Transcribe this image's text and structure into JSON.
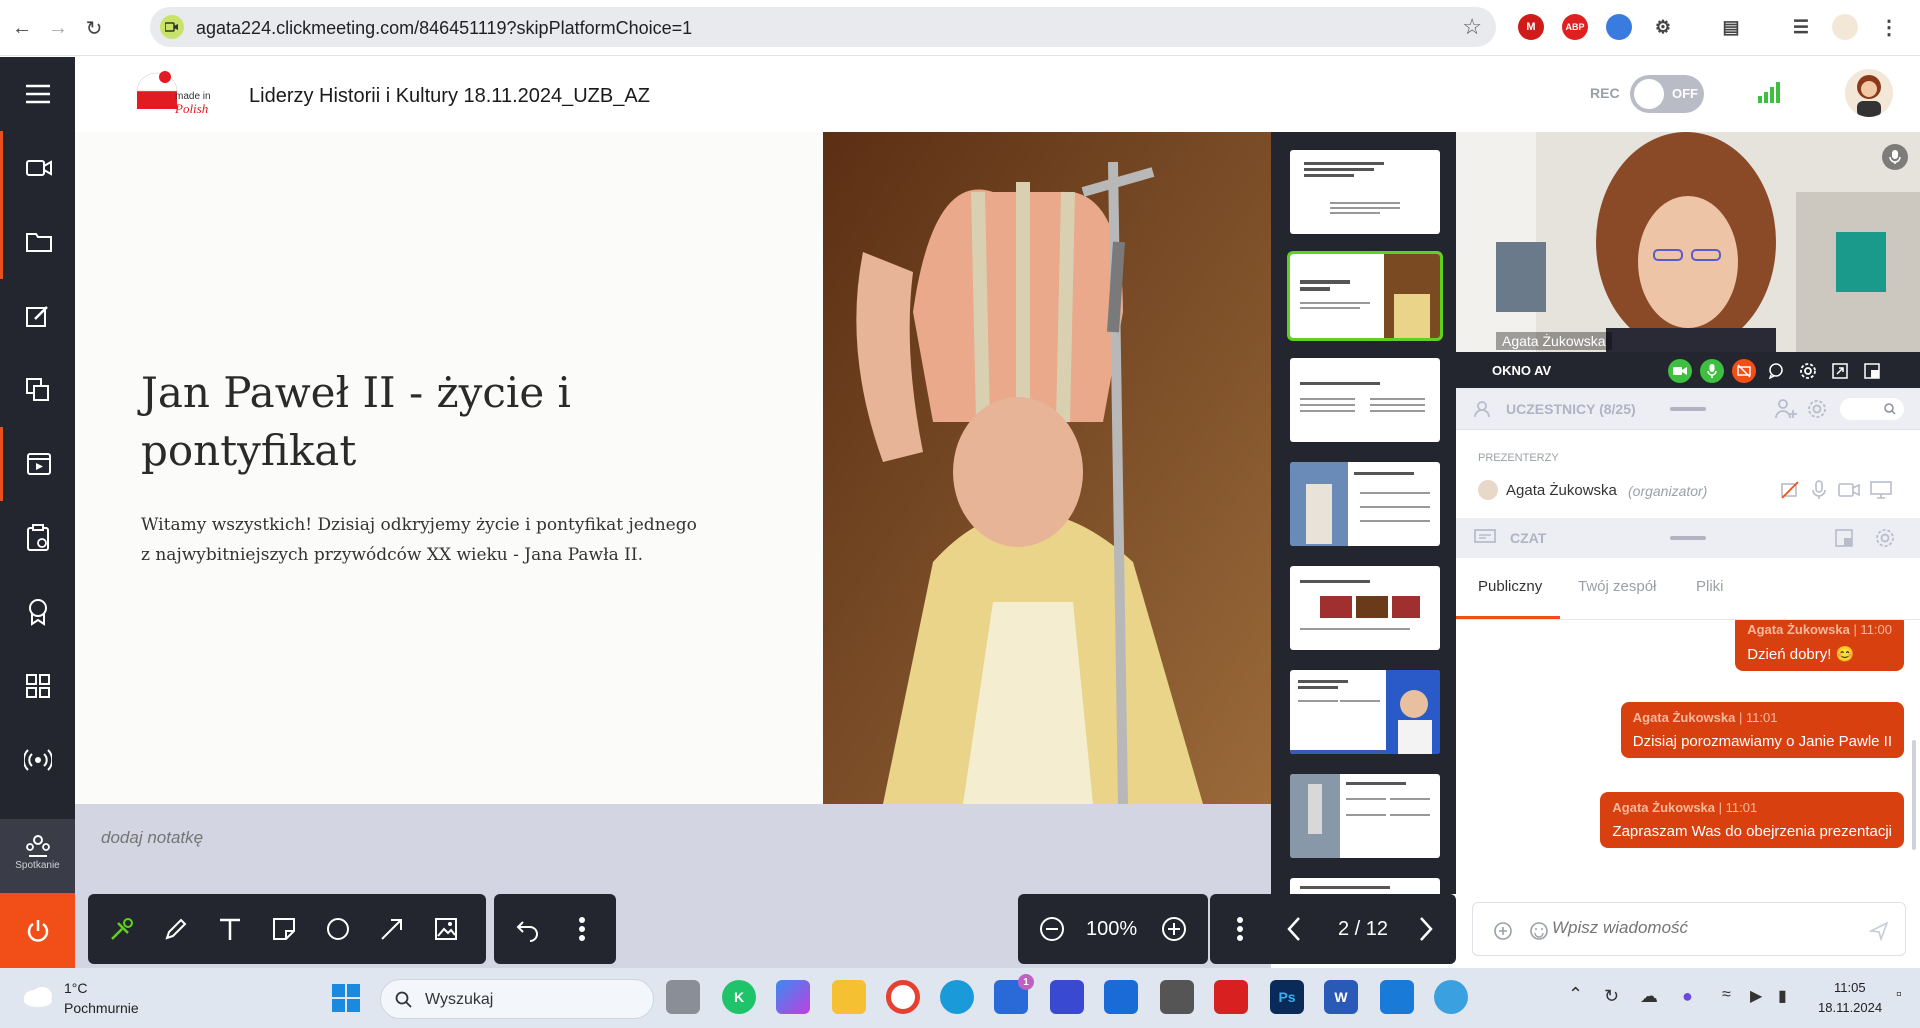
{
  "browser": {
    "url": "agata224.clickmeeting.com/846451119?skipPlatformChoice=1",
    "extensions": [
      "M",
      "ABP"
    ]
  },
  "sidebar": {
    "meeting_label": "Spotkanie"
  },
  "header": {
    "title": "Liderzy Historii i Kultury 18.11.2024_UZB_AZ",
    "logo_text": "made in Polish",
    "rec_label": "REC",
    "rec_state": "OFF"
  },
  "slide": {
    "title": "Jan Paweł II - życie i pontyfikat",
    "text": "Witamy wszystkich! Dzisiaj odkryjemy życie i pontyfikat jednego z najwybitniejszych przywódców XX wieku - Jana Pawła II."
  },
  "notes": {
    "placeholder": "dodaj notatkę"
  },
  "toolbar": {
    "zoom": "100%",
    "page": "2 / 12"
  },
  "video": {
    "name": "Agata Żukowska"
  },
  "av": {
    "label": "OKNO AV"
  },
  "participants": {
    "label": "UCZESTNICY (8/25)",
    "presenters_label": "PREZENTERZY",
    "presenter_name": "Agata Żukowska",
    "presenter_role": "(organizator)"
  },
  "chat": {
    "label": "CZAT",
    "tabs": [
      "Publiczny",
      "Twój zespół",
      "Pliki"
    ],
    "messages": [
      {
        "author": "Agata Żukowska",
        "time": "| 11:00",
        "text": "Dzień dobry! 😊"
      },
      {
        "author": "Agata Żukowska",
        "time": "| 11:01",
        "text": "Dzisiaj porozmawiamy o Janie Pawle II"
      },
      {
        "author": "Agata Żukowska",
        "time": "| 11:01",
        "text": "Zapraszam Was do obejrzenia prezentacji"
      }
    ],
    "input_placeholder": "Wpisz wiadomość"
  },
  "taskbar": {
    "weather_temp": "1°C",
    "weather_desc": "Pochmurnie",
    "search_placeholder": "Wyszukaj",
    "store_badge": "1",
    "time": "11:05",
    "date": "18.11.2024"
  },
  "colors": {
    "accent": "#f24f18",
    "dark": "#23262f",
    "green": "#5fd21f",
    "chat_bubble": "#d94010"
  }
}
